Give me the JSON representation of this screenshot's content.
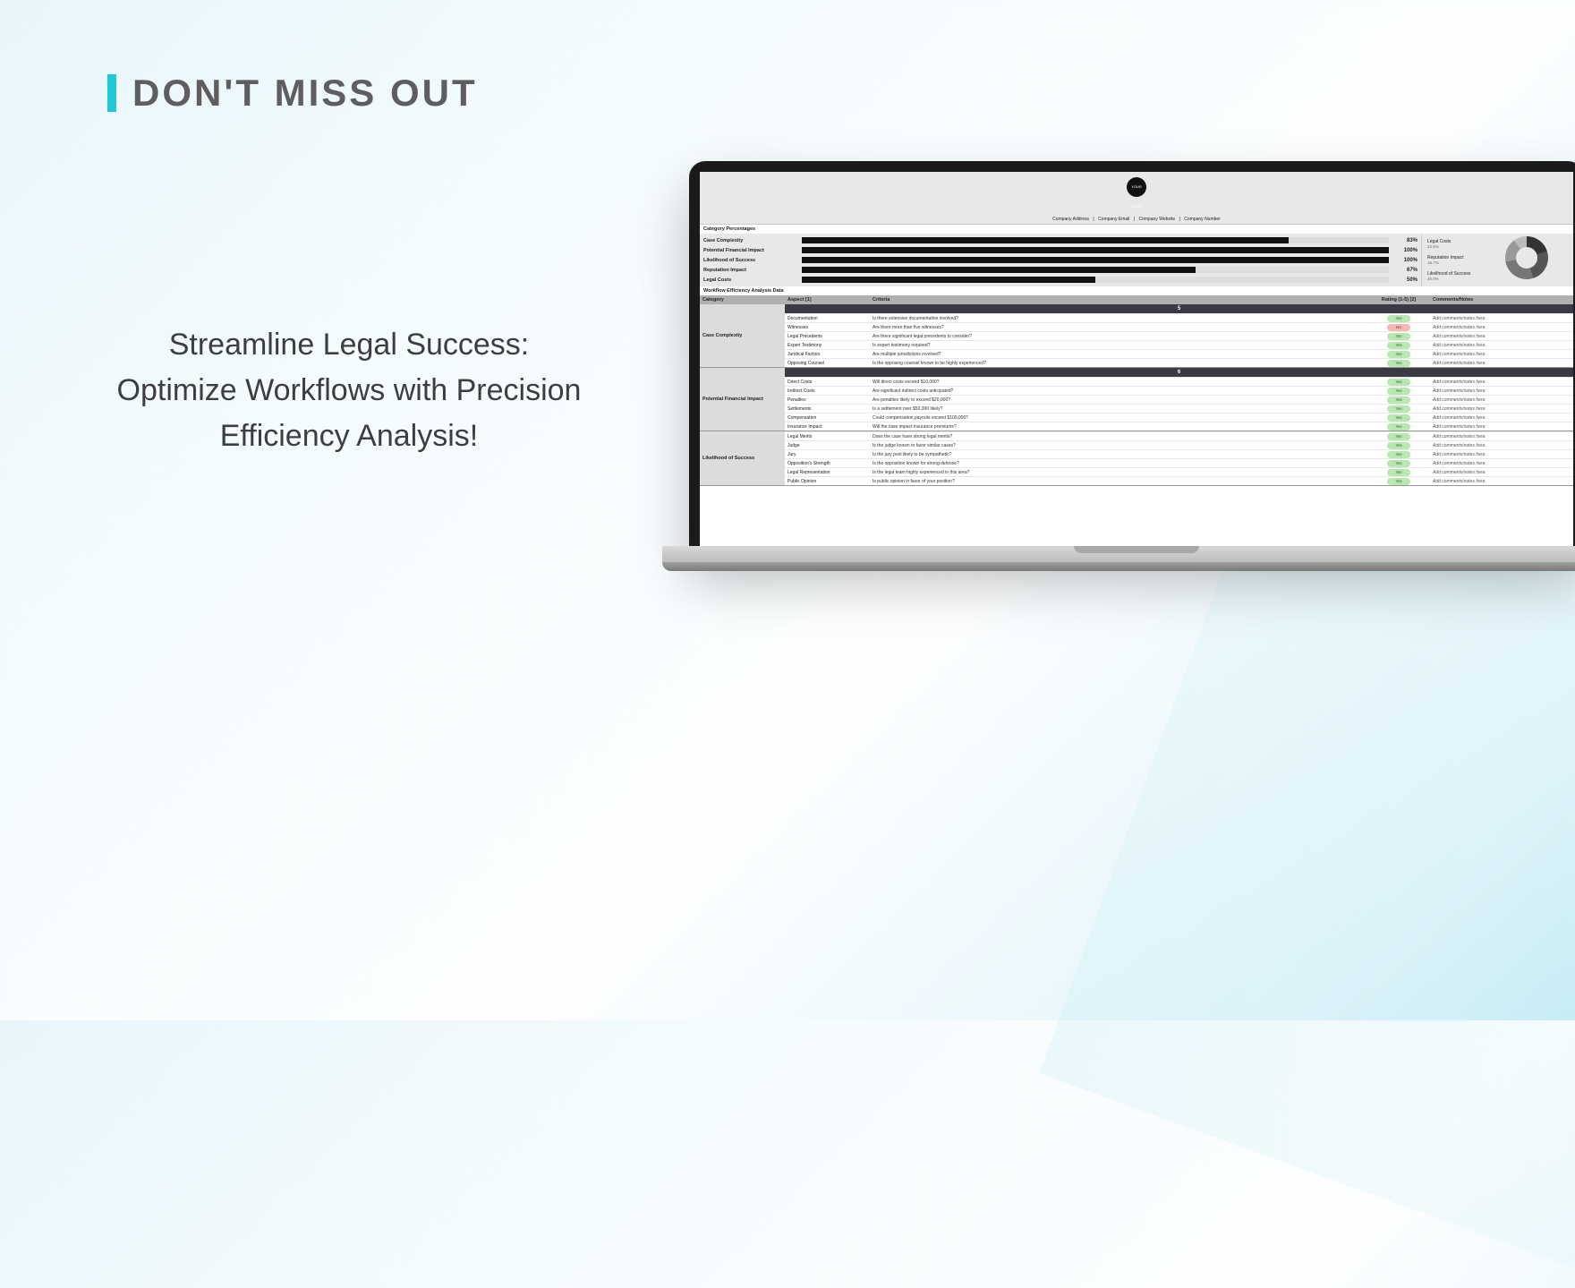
{
  "hero": {
    "title": "DON'T MISS OUT"
  },
  "tagline": "Streamline Legal Success: Optimize Workflows with Precision Efficiency Analysis!",
  "sheet": {
    "logo_text": "YOUR LOGO",
    "meta": [
      "Company Address",
      "Company Email",
      "Company Website",
      "Company Number"
    ],
    "pct_label": "Category Percentages",
    "percentages": [
      {
        "name": "Case Complexity",
        "value": 83,
        "display": "83%"
      },
      {
        "name": "Potential Financial Impact",
        "value": 100,
        "display": "100%"
      },
      {
        "name": "Likelihood of Success",
        "value": 100,
        "display": "100%"
      },
      {
        "name": "Reputation Impact",
        "value": 67,
        "display": "67%"
      },
      {
        "name": "Legal Costs",
        "value": 50,
        "display": "50%"
      }
    ],
    "side_labels": [
      {
        "title": "Legal Costs",
        "sub": "12.5%"
      },
      {
        "title": "Reputation Impact",
        "sub": "16.7%"
      },
      {
        "title": "Likelihood of Success",
        "sub": "25.0%"
      }
    ],
    "data_title": "Workflow Efficiency Analysis Data",
    "columns": {
      "category": "Category",
      "aspect": "Aspect [1]",
      "criteria": "Criteria",
      "rating": "Rating (1-5) [2]",
      "comments": "Comments/Notes"
    },
    "comment_placeholder": "Add comments/notes here.",
    "groups": [
      {
        "category": "Case Complexity",
        "rating_header": "5",
        "rows": [
          {
            "aspect": "Documentation",
            "criteria": "Is there extensive documentation involved?",
            "rating": "Yes"
          },
          {
            "aspect": "Witnesses",
            "criteria": "Are there more than five witnesses?",
            "rating": "No"
          },
          {
            "aspect": "Legal Precedents",
            "criteria": "Are there significant legal precedents to consider?",
            "rating": "Yes"
          },
          {
            "aspect": "Expert Testimony",
            "criteria": "Is expert testimony required?",
            "rating": "Yes"
          },
          {
            "aspect": "Juridical Factors",
            "criteria": "Are multiple jurisdictions involved?",
            "rating": "Yes"
          },
          {
            "aspect": "Opposing Counsel",
            "criteria": "Is the opposing counsel known to be highly experienced?",
            "rating": "Yes"
          }
        ]
      },
      {
        "category": "Potential Financial Impact",
        "rating_header": "6",
        "rows": [
          {
            "aspect": "Direct Costs",
            "criteria": "Will direct costs exceed $10,000?",
            "rating": "Yes"
          },
          {
            "aspect": "Indirect Costs",
            "criteria": "Are significant indirect costs anticipated?",
            "rating": "Yes"
          },
          {
            "aspect": "Penalties",
            "criteria": "Are penalties likely to exceed $20,000?",
            "rating": "Yes"
          },
          {
            "aspect": "Settlements",
            "criteria": "Is a settlement over $50,000 likely?",
            "rating": "Yes"
          },
          {
            "aspect": "Compensation",
            "criteria": "Could compensation payouts exceed $100,000?",
            "rating": "Yes"
          },
          {
            "aspect": "Insurance Impact",
            "criteria": "Will the case impact insurance premiums?",
            "rating": "Yes"
          }
        ]
      },
      {
        "category": "Likelihood of Success",
        "rating_header": "",
        "rows": [
          {
            "aspect": "Legal Merits",
            "criteria": "Does the case have strong legal merits?",
            "rating": "Yes"
          },
          {
            "aspect": "Judge",
            "criteria": "Is the judge known to favor similar cases?",
            "rating": "Yes"
          },
          {
            "aspect": "Jury",
            "criteria": "Is the jury pool likely to be sympathetic?",
            "rating": "Yes"
          },
          {
            "aspect": "Opposition's Strength",
            "criteria": "Is the opposition known for strong defense?",
            "rating": "Yes"
          },
          {
            "aspect": "Legal Representation",
            "criteria": "Is the legal team highly experienced in this area?",
            "rating": "Yes"
          },
          {
            "aspect": "Public Opinion",
            "criteria": "Is public opinion in favor of your position?",
            "rating": "Yes"
          }
        ]
      }
    ]
  },
  "chart_data": {
    "type": "bar",
    "title": "Category Percentages",
    "categories": [
      "Case Complexity",
      "Potential Financial Impact",
      "Likelihood of Success",
      "Reputation Impact",
      "Legal Costs"
    ],
    "values": [
      83,
      100,
      100,
      67,
      50
    ],
    "xlabel": "",
    "ylabel": "%",
    "ylim": [
      0,
      100
    ]
  }
}
